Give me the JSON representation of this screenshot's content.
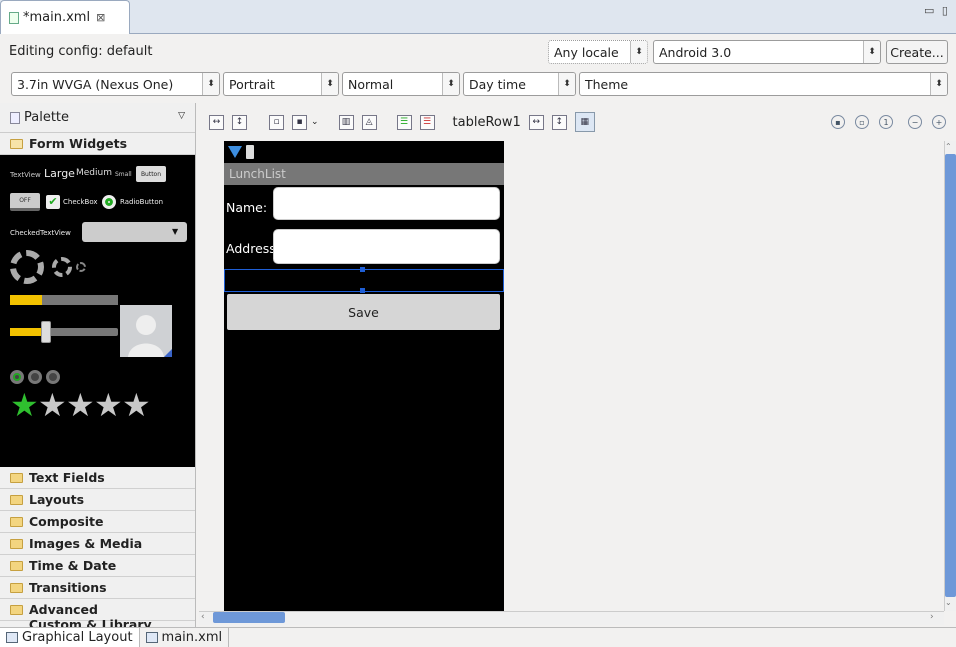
{
  "editor_tab": {
    "title": "*main.xml",
    "close": "⊠"
  },
  "window_controls": "▭ ▯",
  "config": {
    "editing_label": "Editing config: default",
    "locale": "Any locale",
    "target": "Android 3.0",
    "create_button": "Create..."
  },
  "device_row": {
    "device": "3.7in WVGA (Nexus One)",
    "orientation": "Portrait",
    "dock": "Normal",
    "night": "Day time",
    "theme": "Theme"
  },
  "palette": {
    "title": "Palette",
    "open_category": "Form Widgets",
    "categories": [
      "Text Fields",
      "Layouts",
      "Composite",
      "Images & Media",
      "Time & Date",
      "Transitions",
      "Advanced",
      "Custom & Library Views"
    ],
    "widgets": {
      "tv_small": "TextView",
      "tv_large": "Large",
      "tv_medium": "Medium",
      "tv_tiny": "Small",
      "button": "Button",
      "toggle": "OFF",
      "checkbox": "CheckBox",
      "radio": "RadioButton",
      "checked_tv": "CheckedTextView",
      "progress_fill": 0.3,
      "seek_fill": 0.33,
      "rating": 1,
      "rating_max": 5
    }
  },
  "canvas_toolbar": {
    "selection": "tableRow1"
  },
  "device_screen": {
    "app_title": "LunchList",
    "name_label": "Name:",
    "address_label": "Address:",
    "save_button": "Save"
  },
  "bottom_tabs": {
    "graphical": "Graphical Layout",
    "xml": "main.xml"
  },
  "colors": {
    "accent_blue": "#6e98d8",
    "selection": "#1f5fd6",
    "rating_on": "#2fbf2f"
  }
}
